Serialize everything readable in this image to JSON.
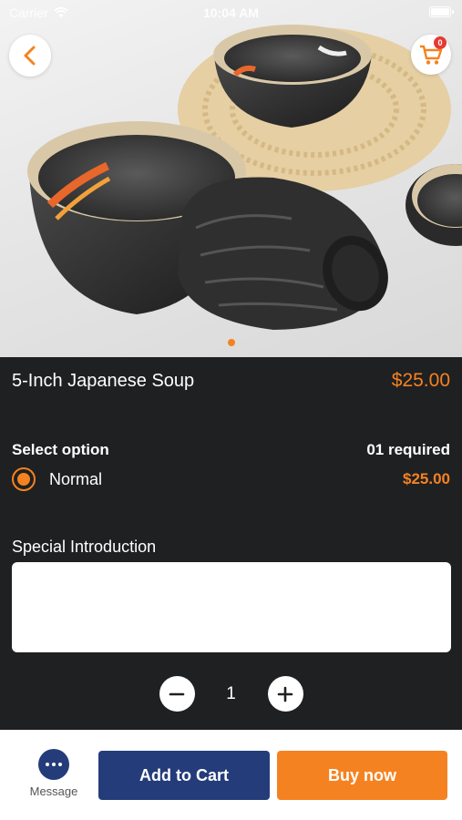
{
  "status_bar": {
    "carrier": "Carrier",
    "time": "10:04 AM"
  },
  "header": {
    "back_icon": "chevron-left-icon",
    "cart_icon": "shopping-cart-icon",
    "cart_count": "0"
  },
  "product": {
    "title": "5-Inch Japanese Soup",
    "price": "$25.00",
    "image_index": 1,
    "image_count": 1
  },
  "options": {
    "label": "Select option",
    "required": "01 required",
    "items": [
      {
        "name": "Normal",
        "price": "$25.00",
        "selected": true
      }
    ]
  },
  "introduction": {
    "label": "Special Introduction",
    "value": "",
    "placeholder": ""
  },
  "quantity": {
    "value": "1"
  },
  "bottom_bar": {
    "message_label": "Message",
    "add_to_cart_label": "Add to Cart",
    "buy_now_label": "Buy now"
  },
  "colors": {
    "accent": "#f58220",
    "primary": "#243c79",
    "background": "#1f2022",
    "badge": "#e53935"
  }
}
